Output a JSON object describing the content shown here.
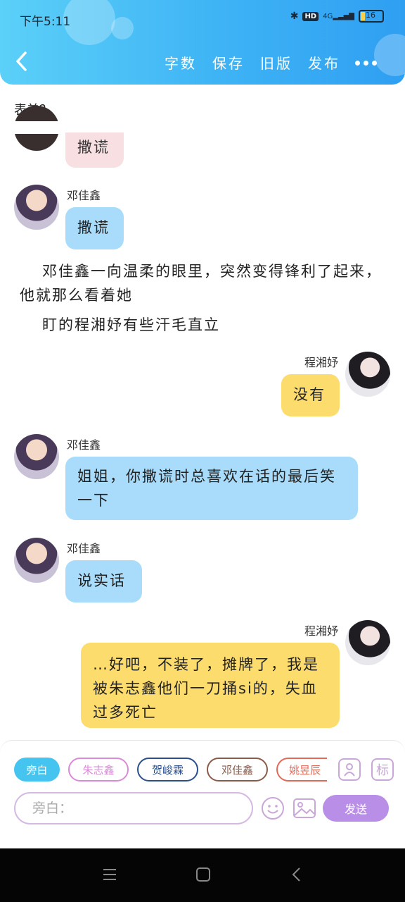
{
  "status": {
    "time": "下午5:11",
    "network": "4G",
    "battery": "16"
  },
  "toolbar": {
    "items": [
      "字数",
      "保存",
      "旧版",
      "发布"
    ]
  },
  "chat": {
    "prev_text": "表弟？",
    "msg0": {
      "text": "撒谎"
    },
    "msg1": {
      "sender": "邓佳鑫",
      "text": "撒谎"
    },
    "narration1": "邓佳鑫一向温柔的眼里，突然变得锋利了起来，他就那么看着她",
    "narration2": "盯的程湘妤有些汗毛直立",
    "msg2": {
      "sender": "程湘妤",
      "text": "没有"
    },
    "msg3": {
      "sender": "邓佳鑫",
      "text": "姐姐，你撒谎时总喜欢在话的最后笑一下"
    },
    "msg4": {
      "sender": "邓佳鑫",
      "text": "说实话"
    },
    "msg5": {
      "sender": "程湘妤",
      "text": "…好吧，不装了，摊牌了，我是被朱志鑫他们一刀捅si的，失血过多死亡"
    }
  },
  "roles": [
    {
      "label": "旁白",
      "color": "#46c4f0"
    },
    {
      "label": "朱志鑫",
      "color": "#d98ad8"
    },
    {
      "label": "贺峻霖",
      "color": "#2b4f8a"
    },
    {
      "label": "邓佳鑫",
      "color": "#8a5a4a"
    },
    {
      "label": "姚昱辰",
      "color": "#e06a5a"
    }
  ],
  "icons": {
    "add_role": "person-add-icon",
    "mark": "标"
  },
  "input": {
    "placeholder": "旁白："
  },
  "send_label": "发送"
}
